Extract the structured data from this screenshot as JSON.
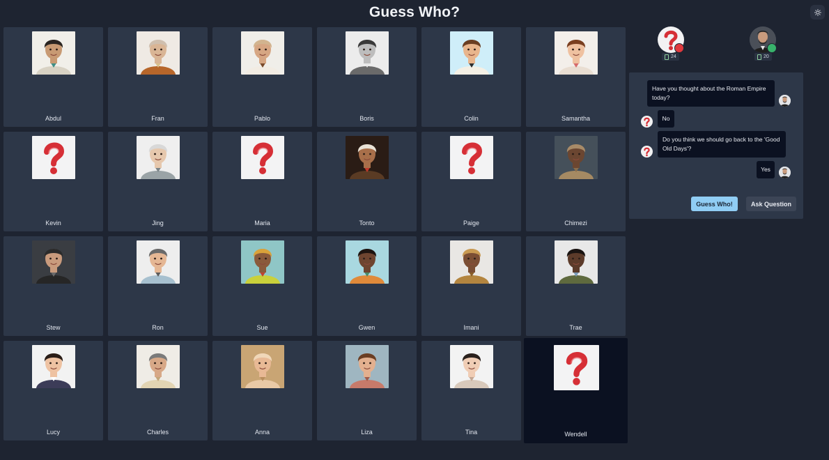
{
  "header": {
    "title": "Guess Who?"
  },
  "theme_toggle": {
    "icon": "sun-icon"
  },
  "characters": [
    {
      "name": "Abdul",
      "kind": "person",
      "bg": "#f1efe9",
      "skin": "#c89a73",
      "hair": "#2a2521",
      "top": "#d8d2c4",
      "accent": "#3f8f86"
    },
    {
      "name": "Fran",
      "kind": "person",
      "bg": "#efeae4",
      "skin": "#d9b595",
      "hair": "#cfbfae",
      "top": "#b7662a",
      "accent": "#d9c08c"
    },
    {
      "name": "Pablo",
      "kind": "person",
      "bg": "#f0eee9",
      "skin": "#d6a683",
      "hair": "#d2b48f",
      "top": "#f2ece3",
      "accent": "#7a4a2a"
    },
    {
      "name": "Boris",
      "kind": "person",
      "bg": "#ececec",
      "skin": "#bdbdbd",
      "hair": "#3a3a3a",
      "top": "#6a6a6a",
      "accent": "#e8e8e8"
    },
    {
      "name": "Colin",
      "kind": "person",
      "bg": "#cfeef9",
      "skin": "#e8b58c",
      "hair": "#6a3e22",
      "top": "#f4f0e5",
      "accent": "#2f2f2f"
    },
    {
      "name": "Samantha",
      "kind": "person",
      "bg": "#f3efea",
      "skin": "#efc1a0",
      "hair": "#7a3f20",
      "top": "#e9ded2",
      "accent": "#d66b6b"
    },
    {
      "name": "Kevin",
      "kind": "unknown"
    },
    {
      "name": "Jing",
      "kind": "person",
      "bg": "#efefef",
      "skin": "#e6c8ad",
      "hair": "#d8d8d8",
      "top": "#9aa3a6",
      "accent": "#7b8487"
    },
    {
      "name": "Maria",
      "kind": "unknown"
    },
    {
      "name": "Tonto",
      "kind": "person",
      "bg": "#2a1c15",
      "skin": "#a86f4a",
      "hair": "#e9e2d6",
      "top": "#5a3b24",
      "accent": "#c0392b"
    },
    {
      "name": "Paige",
      "kind": "unknown"
    },
    {
      "name": "Chimezi",
      "kind": "person",
      "bg": "#45505a",
      "skin": "#6b4631",
      "hair": "#a88b68",
      "top": "#a58a63",
      "accent": "#8a6d4b"
    },
    {
      "name": "Stew",
      "kind": "person",
      "bg": "#3a3d42",
      "skin": "#c99b7d",
      "hair": "#2b2b2b",
      "top": "#262626",
      "accent": "#6a6a6a"
    },
    {
      "name": "Ron",
      "kind": "person",
      "bg": "#eeeeee",
      "skin": "#e5b794",
      "hair": "#6a6a6a",
      "top": "#a7c0cf",
      "accent": "#5c5c5c"
    },
    {
      "name": "Sue",
      "kind": "person",
      "bg": "#8fc6c6",
      "skin": "#8a5a3b",
      "hair": "#d9a23a",
      "top": "#c9d13b",
      "accent": "#c0432f"
    },
    {
      "name": "Gwen",
      "kind": "person",
      "bg": "#a9d8e0",
      "skin": "#6e4530",
      "hair": "#1e1511",
      "top": "#e08a3a",
      "accent": "#4a8c6a"
    },
    {
      "name": "Imani",
      "kind": "person",
      "bg": "#e9e7e4",
      "skin": "#7b4e34",
      "hair": "#c99a52",
      "top": "#b3853f",
      "accent": "#8a5f2a"
    },
    {
      "name": "Trae",
      "kind": "person",
      "bg": "#e8e8e8",
      "skin": "#5c3b2a",
      "hair": "#1a1412",
      "top": "#5f6a3e",
      "accent": "#7a9bb8"
    },
    {
      "name": "Lucy",
      "kind": "person",
      "bg": "#f2f2f2",
      "skin": "#eec2a2",
      "hair": "#2a1d17",
      "top": "#3c3c58",
      "accent": "#ffffff"
    },
    {
      "name": "Charles",
      "kind": "person",
      "bg": "#efece6",
      "skin": "#d7a887",
      "hair": "#7a7a7a",
      "top": "#e2d4b3",
      "accent": "#c4a67a"
    },
    {
      "name": "Anna",
      "kind": "person",
      "bg": "#c9a574",
      "skin": "#e8b995",
      "hair": "#f0d7b8",
      "top": "#e9c9a6",
      "accent": "#b98e5e"
    },
    {
      "name": "Liza",
      "kind": "person",
      "bg": "#9fb6c1",
      "skin": "#e3b08f",
      "hair": "#6b3e23",
      "top": "#c77a6a",
      "accent": "#a25b4a"
    },
    {
      "name": "Tina",
      "kind": "person",
      "bg": "#f3f3f3",
      "skin": "#f0cdb5",
      "hair": "#2a211d",
      "top": "#d8c9bb",
      "accent": "#c4a793"
    },
    {
      "name": "Wendell",
      "kind": "unknown",
      "selected": true
    }
  ],
  "players": [
    {
      "name_icon": "question-mark-avatar",
      "status": "offline",
      "status_color": "#e0393e",
      "count": "24"
    },
    {
      "name_icon": "man-portrait-avatar",
      "status": "online",
      "status_color": "#38b26b",
      "count": "20"
    }
  ],
  "chat": {
    "messages": [
      {
        "text": "Have you thought about the Roman Empire today?",
        "side": "right",
        "sender": "opponent"
      },
      {
        "text": "No",
        "side": "left",
        "sender": "player"
      },
      {
        "text": "Do you think we should go back to the 'Good Old Days'?",
        "side": "left",
        "sender": "player"
      },
      {
        "text": "Yes",
        "side": "right",
        "sender": "opponent"
      }
    ],
    "guess_button": "Guess Who!",
    "ask_button": "Ask Question"
  }
}
